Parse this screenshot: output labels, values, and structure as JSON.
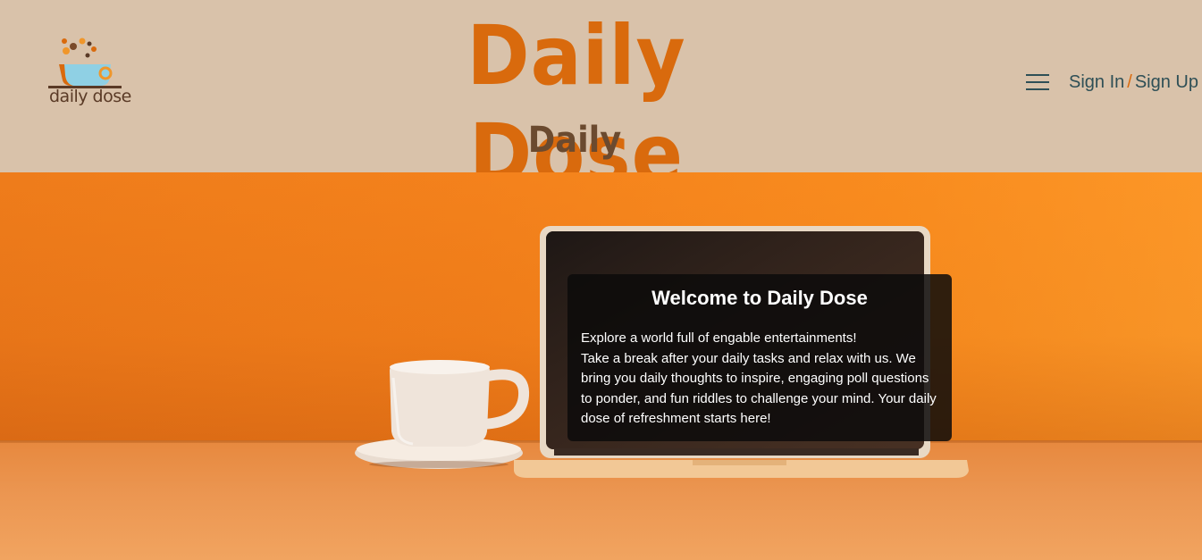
{
  "header": {
    "logo_text": "daily dose",
    "title": "Daily Dose",
    "subtitle": "Daily Entertainments",
    "menu_icon": "hamburger-menu-icon",
    "sign_in_label": "Sign In",
    "separator": "/",
    "sign_up_label": "Sign Up"
  },
  "hero": {
    "welcome_title": "Welcome to Daily Dose",
    "line1": "Explore a world full of engable entertainments!",
    "line2": "Take a break after your daily tasks and relax with us. We bring you daily thoughts to inspire, engaging poll questions to ponder, and fun riddles to challenge your mind. Your daily dose of refreshment starts here!"
  },
  "colors": {
    "header_bg": "#d9c2aa",
    "brand_orange": "#d96a0d",
    "brand_brown": "#6b4a2f",
    "link_teal": "#2e4f56"
  }
}
